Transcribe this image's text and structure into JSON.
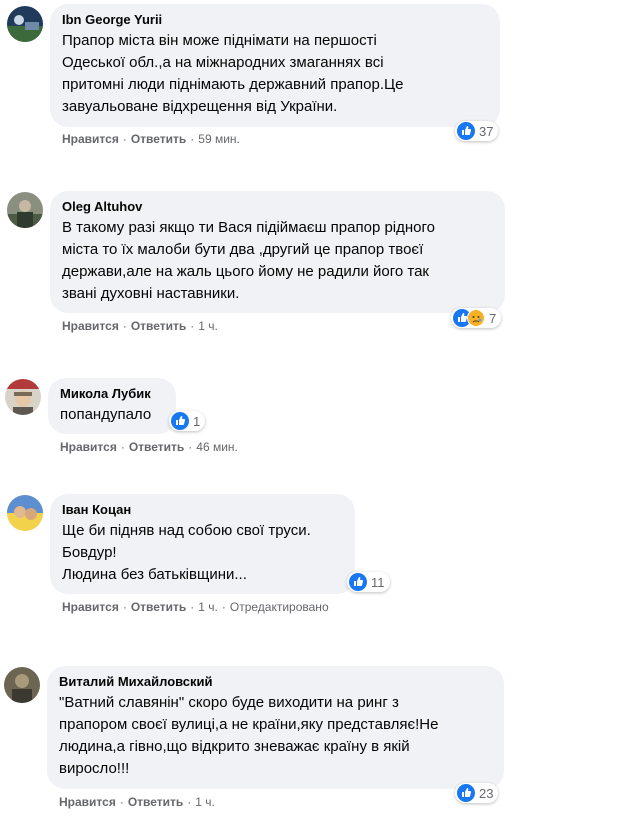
{
  "actions": {
    "like": "Нравится",
    "reply": "Ответить",
    "separator": "·"
  },
  "comments": [
    {
      "author": "Ibn George Yurii",
      "text": "Прапор міста він може піднімати на першості\nОдеської обл.,а на міжнародних змаганнях всі\nпритомні люди піднімають державний прапор.Це\nзавуальоване відхрещення від України.",
      "time": "59 мин.",
      "reactions": [
        "like"
      ],
      "reaction_count": "37"
    },
    {
      "author": "Oleg Altuhov",
      "text": "В такому разі якщо ти Вася підіймаєш прапор рідного\nміста то їх малоби бути два ,другий це прапор твоєї\nдержави,але на жаль цього йому не радили його так\nзвані духовні наставники.",
      "time": "1 ч.",
      "reactions": [
        "like",
        "sad"
      ],
      "reaction_count": "7"
    },
    {
      "author": "Микола Лубик",
      "text": "попандупало",
      "time": "46 мин.",
      "reactions": [
        "like"
      ],
      "reaction_count": "1"
    },
    {
      "author": "Іван Коцан",
      "text": "Ще би підняв над собою свої труси.\nБовдур!\nЛюдина без батьківщини...",
      "time": "1 ч.",
      "edited": "Отредактировано",
      "reactions": [
        "like"
      ],
      "reaction_count": "11"
    },
    {
      "author": "Виталий Михайловский",
      "text": "\"Ватний славянін\" скоро буде виходити на ринг з\nпрапором своєї вулиці,а не країни,яку представляє!Не\nлюдина,а гівно,що відкрито зневажає країну в якій\nвиросло!!!",
      "time": "1 ч.",
      "reactions": [
        "like"
      ],
      "reaction_count": "23"
    }
  ],
  "colors": {
    "bubble": "#f0f2f5",
    "like": "#1877f2",
    "sad": "#f7b125",
    "meta": "#65676b"
  }
}
